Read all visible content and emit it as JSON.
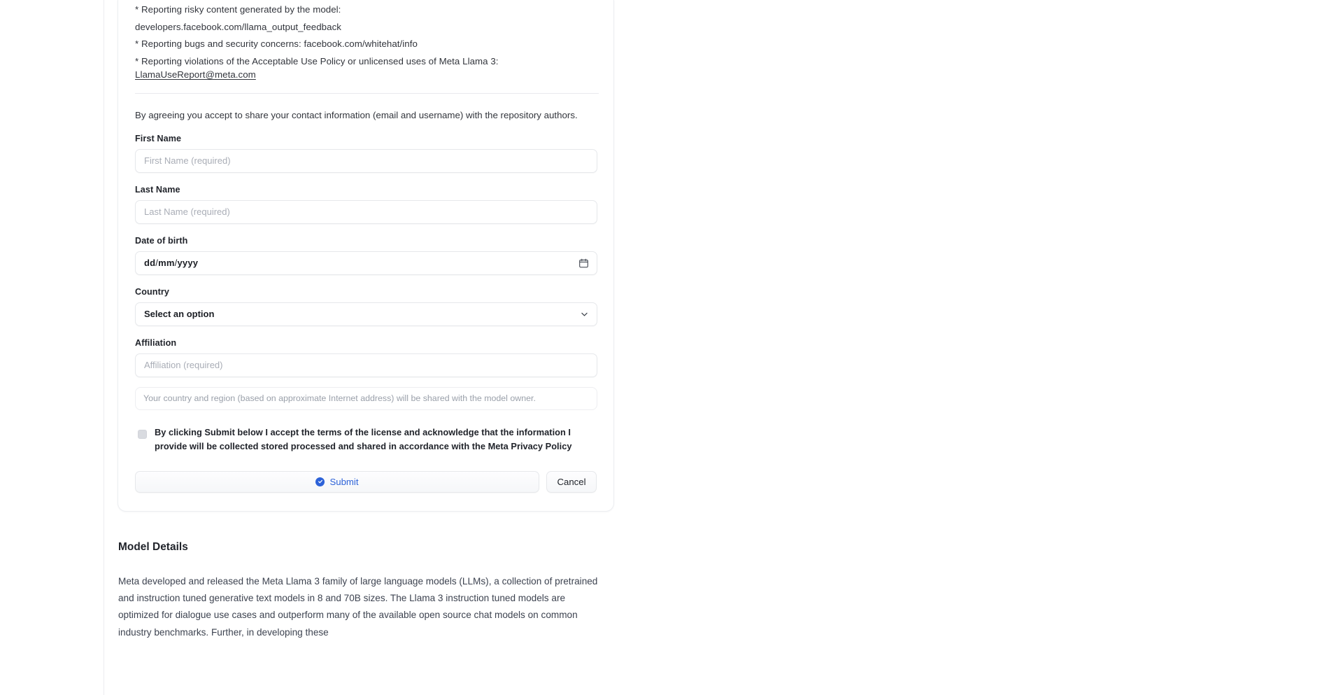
{
  "gating": {
    "policy_lines": [
      "* Reporting risky content generated by the model:",
      "developers.facebook.com/llama_output_feedback",
      "* Reporting bugs and security concerns: facebook.com/whitehat/info"
    ],
    "violation_line_prefix": "* Reporting violations of the Acceptable Use Policy or unlicensed uses of Meta Llama 3: ",
    "violation_email": "LlamaUseReport@meta.com",
    "consent_note": "By agreeing you accept to share your contact information (email and username) with the repository authors.",
    "fields": {
      "first_name": {
        "label": "First Name",
        "placeholder": "First Name (required)",
        "value": ""
      },
      "last_name": {
        "label": "Last Name",
        "placeholder": "Last Name (required)",
        "value": ""
      },
      "date_of_birth": {
        "label": "Date of birth",
        "value": "dd/mm/yyyy",
        "day": "dd",
        "month": "mm",
        "year": "yyyy",
        "icon": "calendar-icon"
      },
      "country": {
        "label": "Country",
        "selected": "Select an option",
        "icon": "chevron-down-icon"
      },
      "affiliation": {
        "label": "Affiliation",
        "placeholder": "Affiliation (required)",
        "value": ""
      }
    },
    "geo_note": "Your country and region (based on approximate Internet address) will be shared with the model owner.",
    "terms_checkbox": {
      "checked": false,
      "text": "By clicking Submit below I accept the terms of the license and acknowledge that the information I provide will be collected stored processed and shared in accordance with the Meta Privacy Policy"
    },
    "submit_button": {
      "label": "Submit",
      "icon": "check-circle-icon",
      "color": "#2d62d8"
    },
    "cancel_button": {
      "label": "Cancel"
    }
  },
  "model_details": {
    "title": "Model Details",
    "paragraph": "Meta developed and released the Meta Llama 3 family of large language models (LLMs), a collection of pretrained and instruction tuned generative text models in 8 and 70B sizes. The Llama 3 instruction tuned models are optimized for dialogue use cases and outperform many of the available open source chat models on common industry benchmarks. Further, in developing these"
  }
}
